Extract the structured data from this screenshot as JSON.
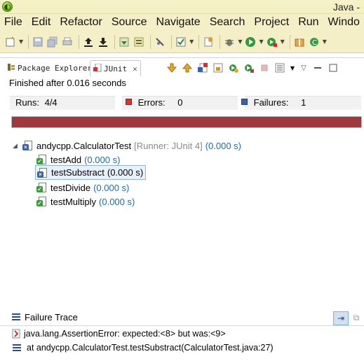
{
  "window": {
    "title": "Java -"
  },
  "menu": {
    "items": [
      "File",
      "Edit",
      "Refactor",
      "Source",
      "Navigate",
      "Search",
      "Project",
      "Run",
      "Windo"
    ]
  },
  "tabs": {
    "package_explorer": "Package Explorer",
    "junit": "JUnit"
  },
  "junit": {
    "status": "Finished after 0.016 seconds",
    "runs_label": "Runs:",
    "runs_value": "4/4",
    "errors_label": "Errors:",
    "errors_value": "0",
    "failures_label": "Failures:",
    "failures_value": "1",
    "progress_fraction": 1.0,
    "progress_color": "#a1383d",
    "suite": {
      "name": "andycpp.CalculatorTest",
      "runner": "[Runner: JUnit 4]",
      "time": "(0.000 s)"
    },
    "tests": [
      {
        "name": "testAdd",
        "time": "(0.000 s)",
        "status": "passed"
      },
      {
        "name": "testSubstract",
        "time": "(0.000 s)",
        "status": "failed"
      },
      {
        "name": "testDivide",
        "time": "(0.000 s)",
        "status": "passed"
      },
      {
        "name": "testMultiply",
        "time": "(0.000 s)",
        "status": "passed"
      }
    ]
  },
  "failure_trace": {
    "title": "Failure Trace",
    "lines": [
      "java.lang.AssertionError: expected:<8> but was:<9>",
      "at andycpp.CalculatorTest.testSubstract(CalculatorTest.java:27)"
    ]
  }
}
